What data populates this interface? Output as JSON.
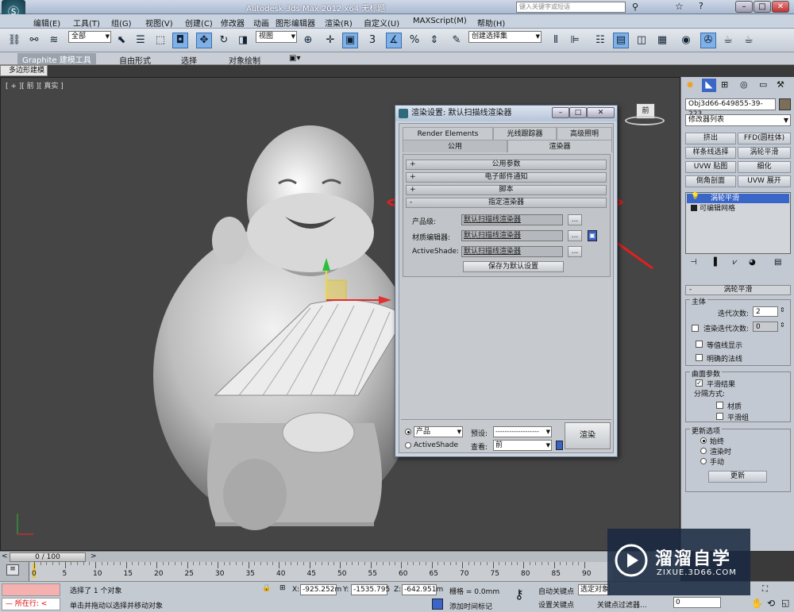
{
  "window": {
    "title_text": "Autodesk 3ds Max  2012 x64      无标题",
    "search_placeholder": "键入关键字或短语"
  },
  "menu": {
    "items": [
      "编辑(E)",
      "工具(T)",
      "组(G)",
      "视图(V)",
      "创建(C)",
      "修改器",
      "动画",
      "图形编辑器",
      "渲染(R)",
      "自定义(U)",
      "MAXScript(M)",
      "帮助(H)"
    ]
  },
  "toolbar": {
    "selection_filter": "全部",
    "reference_coord": "视图",
    "named_selection": "创建选择集",
    "snap_value": "3"
  },
  "ribbon": {
    "tabs": [
      "Graphite 建模工具",
      "自由形式",
      "选择",
      "对象绘制"
    ],
    "subtab": "多边形建模"
  },
  "viewport": {
    "label": "[ + ][ 前 ][ 真实 ]",
    "viewcube_label": "前"
  },
  "render_dialog": {
    "title": "渲染设置: 默认扫描线渲染器",
    "tabs_row1": [
      "Render Elements",
      "光线跟踪器",
      "高级照明"
    ],
    "tabs_row2": [
      "公用",
      "渲染器"
    ],
    "rollouts": [
      {
        "sign": "+",
        "label": "公用参数"
      },
      {
        "sign": "+",
        "label": "电子邮件通知"
      },
      {
        "sign": "+",
        "label": "脚本"
      },
      {
        "sign": "-",
        "label": "指定渲染器"
      }
    ],
    "assign": {
      "production_label": "产品级:",
      "production_value": "默认扫描线渲染器",
      "material_label": "材质编辑器:",
      "material_value": "默认扫描线渲染器",
      "activeshade_label": "ActiveShade:",
      "activeshade_value": "默认扫描线渲染器",
      "browse": "...",
      "save_default": "保存为默认设置"
    },
    "bottom": {
      "mode_production": "产品",
      "mode_activeshade": "ActiveShade",
      "preset_label": "预设:",
      "preset_value": "-------------------",
      "view_label": "查看:",
      "view_value": "前",
      "render_button": "渲染"
    }
  },
  "command_panel": {
    "object_name": "Obj3d66-649855-39-223",
    "modifier_list": "修改器列表",
    "modifier_buttons": [
      "挤出",
      "FFD(圆柱体)",
      "样条线选择",
      "涡轮平滑",
      "UVW 贴图",
      "细化",
      "倒角剖面",
      "UVW 展开"
    ],
    "stack": [
      "涡轮平滑",
      "可编辑网格"
    ],
    "rollout_title": "涡轮平滑",
    "main_group": "主体",
    "iterations_label": "迭代次数:",
    "iterations_value": "2",
    "render_iters_label": "渲染迭代次数:",
    "render_iters_value": "0",
    "isoline": "等值线显示",
    "explicit_normals": "明确的法线",
    "surface_group": "曲面参数",
    "smooth_result": "平滑结果",
    "separate_by": "分隔方式:",
    "material": "材质",
    "smoothing_groups": "平滑组",
    "update_group": "更新选项",
    "always": "始终",
    "when_rendering": "渲染时",
    "manually": "手动",
    "update_button": "更新"
  },
  "timeline": {
    "frame": "0 / 100",
    "ticks": [
      "0",
      "5",
      "10",
      "15",
      "20",
      "25",
      "30",
      "35",
      "40",
      "45",
      "50",
      "55",
      "60",
      "65",
      "70",
      "75",
      "80",
      "85",
      "90"
    ]
  },
  "status": {
    "script_label": "所在行:",
    "selection_msg": "选择了 1 个对象",
    "prompt_msg": "单击并拖动以选择并移动对象",
    "x_label": "X:",
    "x_value": "-925.252m",
    "y_label": "Y:",
    "y_value": "-1535.795",
    "z_label": "Z:",
    "z_value": "-642.951m",
    "grid": "栅格 = 0.0mm",
    "auto_key": "自动关键点",
    "selected": "选定对象",
    "set_key": "设置关键点",
    "key_filters": "关键点过滤器...",
    "add_time_tag": "添加时间标记",
    "frame_field": "0"
  },
  "watermark": {
    "brand": "溜溜自学",
    "url": "ZIXUE.3D66.COM"
  },
  "colors": {
    "highlight_ellipse": "#e02020",
    "stack_selected": "#3a66c8"
  }
}
